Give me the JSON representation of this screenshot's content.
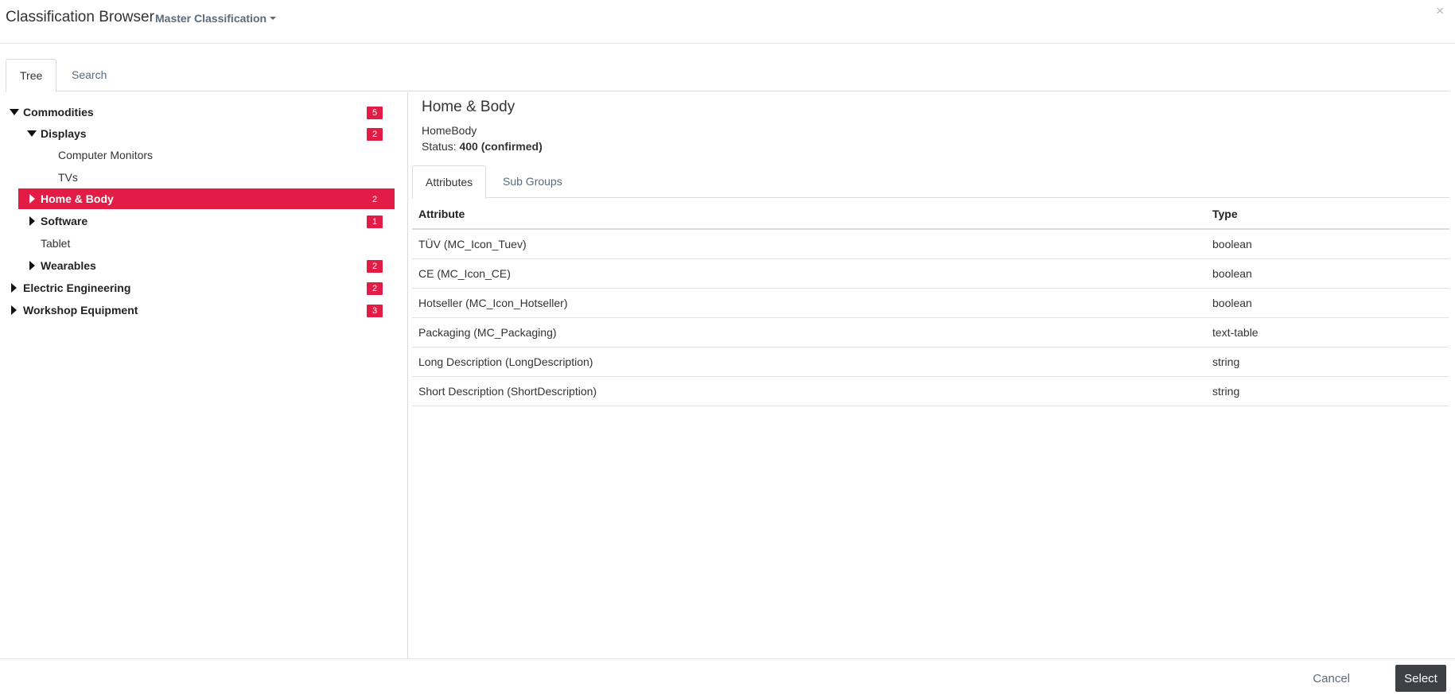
{
  "header": {
    "title": "Classification Browser",
    "classification_selector": "Master Classification",
    "close_label": "×"
  },
  "main_tabs": [
    {
      "label": "Tree",
      "active": true
    },
    {
      "label": "Search",
      "active": false
    }
  ],
  "tree": [
    {
      "label": "Commodities",
      "count": "5",
      "expanded": true
    },
    {
      "label": "Displays",
      "count": "2",
      "expanded": true
    },
    {
      "label": "Computer Monitors"
    },
    {
      "label": "TVs"
    },
    {
      "label": "Home & Body",
      "count": "2",
      "selected": true
    },
    {
      "label": "Software",
      "count": "1"
    },
    {
      "label": "Tablet"
    },
    {
      "label": "Wearables",
      "count": "2"
    },
    {
      "label": "Electric Engineering",
      "count": "2"
    },
    {
      "label": "Workshop Equipment",
      "count": "3"
    }
  ],
  "detail": {
    "name": "Home & Body",
    "code": "HomeBody",
    "status_label": "Status:",
    "status_value": "400 (confirmed)",
    "tabs": [
      {
        "label": "Attributes",
        "active": true
      },
      {
        "label": "Sub Groups",
        "active": false
      }
    ],
    "table": {
      "headers": [
        "Attribute",
        "Type"
      ],
      "rows": [
        [
          "TÜV (MC_Icon_Tuev)",
          "boolean"
        ],
        [
          "CE (MC_Icon_CE)",
          "boolean"
        ],
        [
          "Hotseller (MC_Icon_Hotseller)",
          "boolean"
        ],
        [
          "Packaging (MC_Packaging)",
          "text-table"
        ],
        [
          "Long Description (LongDescription)",
          "string"
        ],
        [
          "Short Description (ShortDescription)",
          "string"
        ]
      ]
    }
  },
  "footer": {
    "cancel_label": "Cancel",
    "select_label": "Select"
  },
  "colors": {
    "accent": "#e31c46",
    "primary_button": "#3d4145",
    "link": "#5a6b7b"
  }
}
